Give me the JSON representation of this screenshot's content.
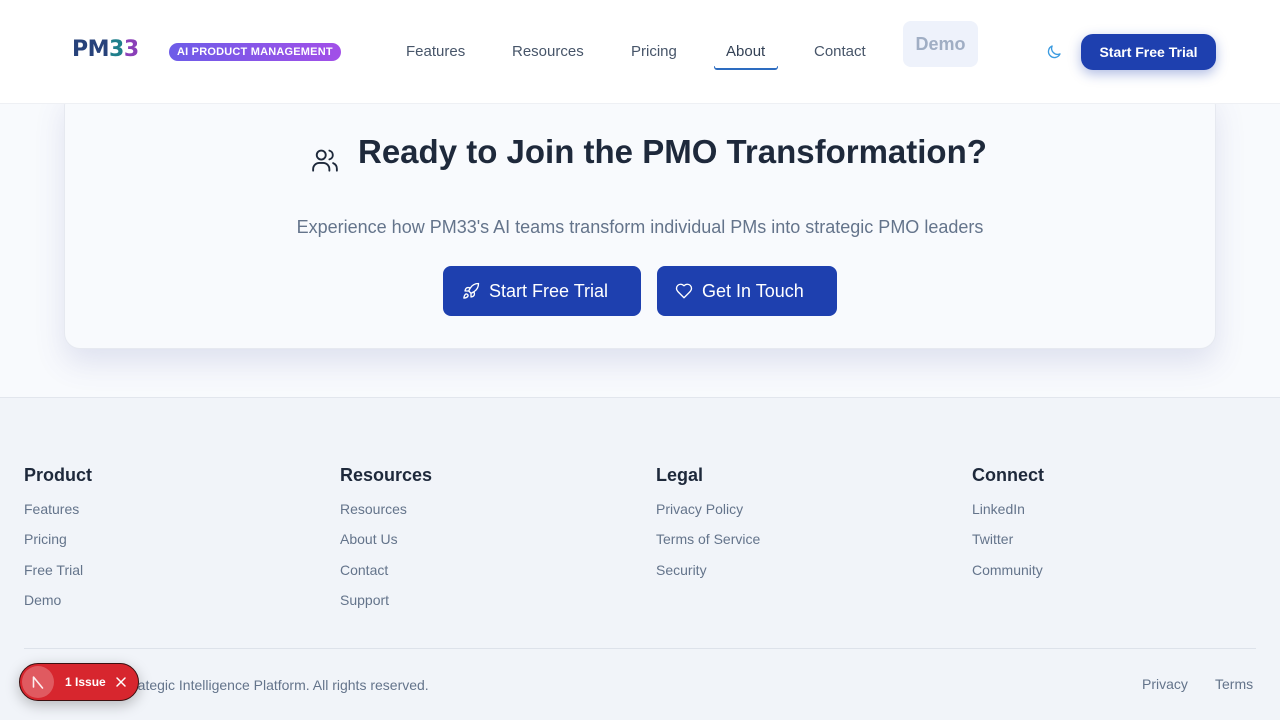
{
  "header": {
    "logo_pm": "PM",
    "logo_3a": "3",
    "logo_3b": "3",
    "badge": "AI PRODUCT MANAGEMENT",
    "nav": [
      "Features",
      "Resources",
      "Pricing",
      "About",
      "Contact"
    ],
    "active_nav": "About",
    "demo_label": "Demo",
    "cta_label": "Start Free Trial",
    "theme_icon": "moon-icon"
  },
  "cta": {
    "icon": "users-icon",
    "title": "Ready to Join the PMO Transformation?",
    "subtitle": "Experience how PM33's AI teams transform individual PMs into strategic PMO leaders",
    "primary_label": "Start Free Trial",
    "primary_icon": "rocket-icon",
    "secondary_label": "Get In Touch",
    "secondary_icon": "heart-icon"
  },
  "footer": {
    "columns": [
      {
        "heading": "Product",
        "links": [
          "Features",
          "Pricing",
          "Free Trial",
          "Demo"
        ]
      },
      {
        "heading": "Resources",
        "links": [
          "Resources",
          "About Us",
          "Contact",
          "Support"
        ]
      },
      {
        "heading": "Legal",
        "links": [
          "Privacy Policy",
          "Terms of Service",
          "Security"
        ]
      },
      {
        "heading": "Connect",
        "links": [
          "LinkedIn",
          "Twitter",
          "Community"
        ]
      }
    ],
    "copyright": "rategic Intelligence Platform. All rights reserved.",
    "bottom_links": [
      "Privacy",
      "Terms"
    ]
  },
  "issue_toast": {
    "label": "1 Issue"
  },
  "colors": {
    "primary": "#1e40af",
    "badge_start": "#6d5ce8",
    "badge_end": "#a24fe8",
    "issue_red": "#d7262e"
  }
}
